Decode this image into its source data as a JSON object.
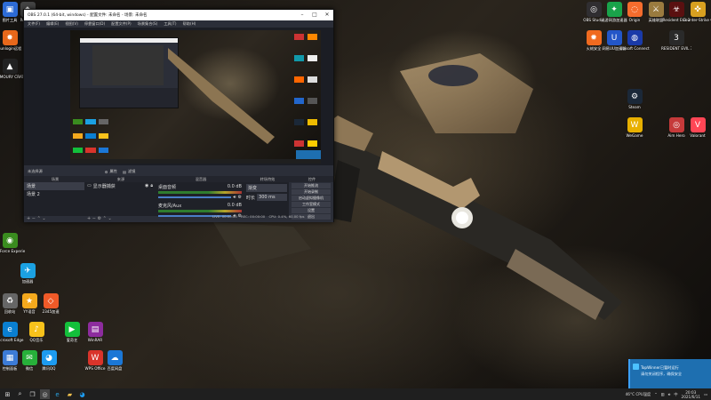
{
  "obs": {
    "title": "OBS 27.0.1 (64-bit, windows) - 配置文件: 未命名 - 场景: 未命名",
    "menu": [
      "文件(F)",
      "编辑(E)",
      "视图(V)",
      "停靠窗口(D)",
      "配置文件(P)",
      "场景集合(S)",
      "工具(T)",
      "帮助(H)"
    ],
    "scene_bar": {
      "label": "未选择源",
      "props": "属性",
      "filters": "滤镜"
    },
    "docks": {
      "scenes": {
        "title": "场景",
        "items": [
          "场景",
          "场景 2"
        ]
      },
      "sources": {
        "title": "来源",
        "items": [
          "显示器捕获"
        ]
      },
      "mixer": {
        "title": "混音器",
        "channels": [
          {
            "name": "桌面音频",
            "db": "0.0 dB"
          },
          {
            "name": "麦克风/Aux",
            "db": "0.0 dB"
          }
        ]
      },
      "transitions": {
        "title": "转场特效",
        "type": "渐变",
        "duration_label": "时长",
        "duration": "300 ms"
      },
      "controls": {
        "title": "控件",
        "buttons": [
          "开始推流",
          "开始录制",
          "启动虚拟摄像机",
          "工作室模式",
          "设置",
          "退出"
        ]
      }
    },
    "status": {
      "live": "LIVE: 00:00:00",
      "rec": "REC: 00:00:00",
      "cpu": "CPU: 0.4%, 60.00 fps"
    }
  },
  "desktop_left": [
    {
      "label": "图片工具",
      "color": "#2d6bd6",
      "glyph": "▣"
    },
    {
      "label": "Rewired",
      "color": "#444",
      "glyph": "◆"
    },
    {
      "label": "Sunlogin远程",
      "color": "#e8681b",
      "glyph": "✸"
    },
    {
      "label": "ARMOURY CRATE",
      "color": "#222",
      "glyph": "▲"
    },
    {
      "label": "GeForce Experience",
      "color": "#3a8c1f",
      "glyph": "◉"
    },
    {
      "label": "加速器",
      "color": "#1ba1e2",
      "glyph": "✈"
    },
    {
      "label": "回收站",
      "color": "#666",
      "glyph": "♻"
    },
    {
      "label": "YY语音",
      "color": "#f4a91d",
      "glyph": "★"
    },
    {
      "label": "Microsoft Edge",
      "color": "#0a7fd1",
      "glyph": "e"
    },
    {
      "label": "QQ音乐",
      "color": "#f8c21b",
      "glyph": "♪"
    },
    {
      "label": "控制面板",
      "color": "#3c7bd6",
      "glyph": "▦"
    },
    {
      "label": "微信",
      "color": "#27b03a",
      "glyph": "✉"
    }
  ],
  "desktop_left_row": [
    {
      "label": "2345加速",
      "color": "#f05a28",
      "glyph": "◇"
    },
    {
      "label": "WinRAR",
      "color": "#8d2c9e",
      "glyph": "▤"
    },
    {
      "label": "爱奇艺",
      "color": "#13c03b",
      "glyph": "▶"
    },
    {
      "label": "腾讯QQ",
      "color": "#1d9bf0",
      "glyph": "◕"
    },
    {
      "label": "WPS Office",
      "color": "#d9342b",
      "glyph": "W"
    },
    {
      "label": "百度网盘",
      "color": "#1b77d6",
      "glyph": "☁"
    }
  ],
  "desktop_right": [
    {
      "label": "OBS Studio",
      "color": "#302e31",
      "glyph": "◎"
    },
    {
      "label": "迅游网游加速器",
      "color": "#19a34a",
      "glyph": "✦"
    },
    {
      "label": "Origin",
      "color": "#f56c2d",
      "glyph": "◌"
    },
    {
      "label": "英雄联盟",
      "color": "#9a7b3f",
      "glyph": "⚔"
    },
    {
      "label": "Resident Evil 2",
      "color": "#5a1010",
      "glyph": "☣"
    },
    {
      "label": "Counter-Strike Global Offensive",
      "color": "#d8a020",
      "glyph": "✜"
    },
    {
      "label": "火绒安全",
      "color": "#f06a1f",
      "glyph": "✹"
    },
    {
      "label": "网易UU加速器",
      "color": "#2356c8",
      "glyph": "U"
    },
    {
      "label": "Ubisoft Connect",
      "color": "#1a3aa8",
      "glyph": "◍"
    },
    {
      "label": "RESIDENT EVIL 3",
      "color": "#2a2a2a",
      "glyph": "3"
    },
    {
      "label": "Steam",
      "color": "#1b2838",
      "glyph": "⚙"
    },
    {
      "label": "WeGame",
      "color": "#e8b000",
      "glyph": "W"
    },
    {
      "label": "Aim Hero",
      "color": "#c53a3a",
      "glyph": "◎"
    },
    {
      "label": "Valorant",
      "color": "#ff4655",
      "glyph": "V"
    }
  ],
  "taskbar": {
    "tray_temp": "46°C CPU温度",
    "time": "20:03",
    "date": "2021/6/11",
    "lang": "中"
  },
  "toast": {
    "title": "TopWinner已暂时运行",
    "subtitle": "请勿关闭程序，确保安全"
  }
}
